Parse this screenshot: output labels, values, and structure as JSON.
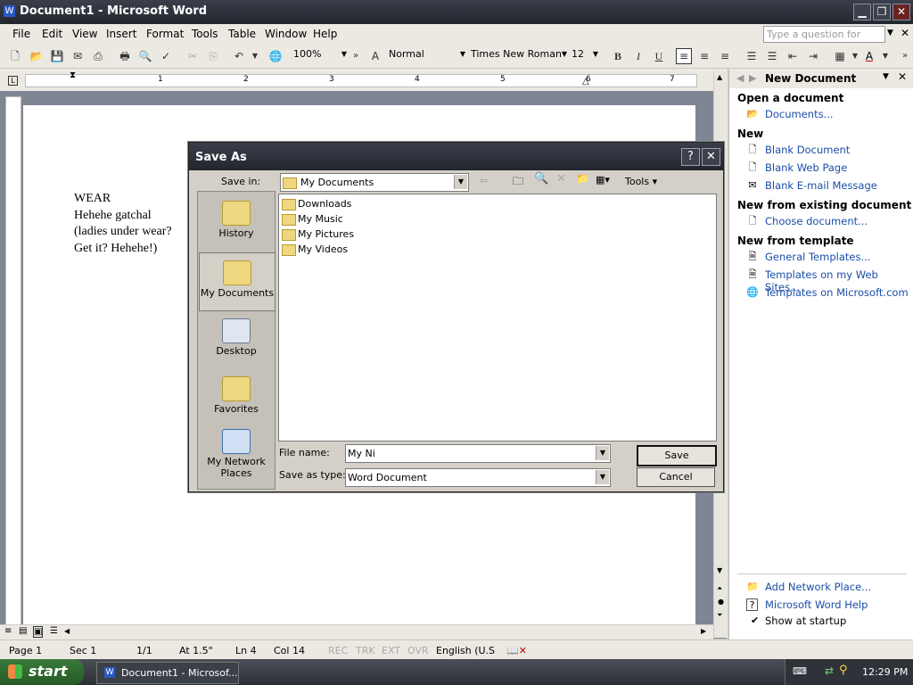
{
  "window": {
    "title": "Document1 - Microsoft Word",
    "min": "▁",
    "max": "❐",
    "close": "✕"
  },
  "menu": [
    "File",
    "Edit",
    "View",
    "Insert",
    "Format",
    "Tools",
    "Table",
    "Window",
    "Help"
  ],
  "ask_placeholder": "Type a question for help",
  "toolbar": {
    "zoom": "100%",
    "style": "Normal",
    "font": "Times New Roman",
    "size": "12",
    "bold": "B",
    "italic": "I",
    "underline": "U"
  },
  "ruler_numbers": [
    "1",
    "2",
    "3",
    "4",
    "5",
    "6",
    "7"
  ],
  "document": {
    "lines": [
      "WEAR",
      "Hehehe gatchal",
      "(ladies under wear?",
      "Get it? Hehehe!)"
    ]
  },
  "taskpane": {
    "title": "New Document",
    "open_header": "Open a document",
    "open_link": "Documents...",
    "new_header": "New",
    "new_links": [
      "Blank Document",
      "Blank Web Page",
      "Blank E-mail Message"
    ],
    "existing_header": "New from existing document",
    "existing_link": "Choose document...",
    "template_header": "New from template",
    "template_links": [
      "General Templates...",
      "Templates on my Web Sites...",
      "Templates on Microsoft.com"
    ],
    "bottom_links": [
      "Add Network Place...",
      "Microsoft Word Help"
    ],
    "show_startup": "Show at startup"
  },
  "status": {
    "page": "Page 1",
    "sec": "Sec 1",
    "pages": "1/1",
    "at": "At 1.5\"",
    "ln": "Ln 4",
    "col": "Col 14",
    "rec": "REC",
    "trk": "TRK",
    "ext": "EXT",
    "ovr": "OVR",
    "lang": "English (U.S"
  },
  "taskbar": {
    "start": "start",
    "item": "Document1 - Microsof...",
    "time": "12:29 PM"
  },
  "dialog": {
    "title": "Save As",
    "help": "?",
    "close": "✕",
    "save_in_label": "Save in:",
    "save_in_value": "My Documents",
    "tools": "Tools",
    "places": [
      "History",
      "My Documents",
      "Desktop",
      "Favorites",
      "My Network Places"
    ],
    "files": [
      "Downloads",
      "My Music",
      "My Pictures",
      "My Videos"
    ],
    "filename_label": "File name:",
    "filename_value": "My Ni",
    "type_label": "Save as type:",
    "type_value": "Word Document",
    "save": "Save",
    "cancel": "Cancel"
  }
}
